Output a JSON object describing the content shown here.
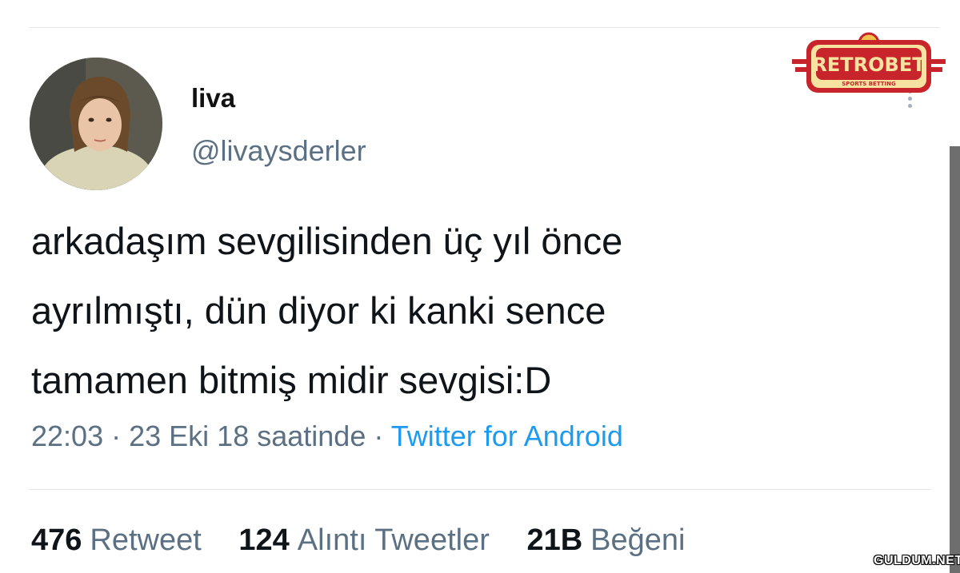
{
  "profile": {
    "display_name": "liva",
    "handle": "@livaysderler"
  },
  "tweet": {
    "text": "arkadaşım sevgilisinden üç yıl önce\nayrılmıştı, dün diyor ki kanki sence\ntamamen bitmiş midir sevgisi:D",
    "time": "22:03",
    "date": "23 Eki 18 saatinde",
    "separator": "·",
    "source": "Twitter for Android"
  },
  "stats": [
    {
      "count": "476",
      "label": "Retweet"
    },
    {
      "count": "124",
      "label": "Alıntı Tweetler"
    },
    {
      "count": "21B",
      "label": "Beğeni"
    }
  ],
  "overlay": {
    "logo_text": "RETROBET",
    "logo_subtext": "SPORTS BETTING",
    "watermark": "GULDUM.NET"
  },
  "colors": {
    "link": "#1d9bf0",
    "secondary_text": "#5b7083",
    "logo_red": "#c8242b",
    "logo_gold": "#f2c14e"
  }
}
